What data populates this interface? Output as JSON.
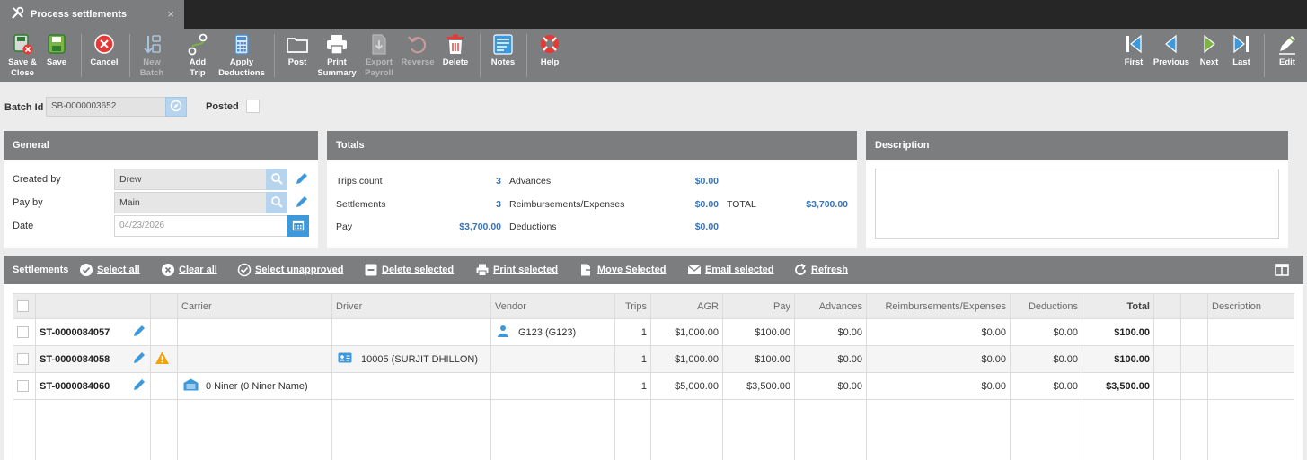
{
  "tab": {
    "title": "Process settlements",
    "close": "×"
  },
  "toolbar": {
    "save_close": [
      "Save &",
      "Close"
    ],
    "save": "Save",
    "cancel": "Cancel",
    "new_batch": [
      "New",
      "Batch"
    ],
    "add_trip": [
      "Add",
      "Trip"
    ],
    "apply_deductions": [
      "Apply",
      "Deductions"
    ],
    "post": "Post",
    "print_summary": [
      "Print",
      "Summary"
    ],
    "export_payroll": [
      "Export",
      "Payroll"
    ],
    "reverse": "Reverse",
    "delete": "Delete",
    "notes": "Notes",
    "help": "Help",
    "first": "First",
    "previous": "Previous",
    "next": "Next",
    "last": "Last",
    "edit": "Edit"
  },
  "batch": {
    "label": "Batch Id",
    "value": "SB-0000003652",
    "posted_label": "Posted"
  },
  "general": {
    "title": "General",
    "created_by_label": "Created by",
    "created_by": "Drew",
    "pay_by_label": "Pay by",
    "pay_by": "Main",
    "date_label": "Date",
    "date": "04/23/2026"
  },
  "totals": {
    "title": "Totals",
    "trips_count_label": "Trips count",
    "trips_count": "3",
    "settlements_label": "Settlements",
    "settlements": "3",
    "pay_label": "Pay",
    "pay": "$3,700.00",
    "advances_label": "Advances",
    "advances": "$0.00",
    "reimb_label": "Reimbursements/Expenses",
    "reimb": "$0.00",
    "deductions_label": "Deductions",
    "deductions": "$0.00",
    "total_label": "TOTAL",
    "total": "$3,700.00"
  },
  "description": {
    "title": "Description"
  },
  "settlements_bar": {
    "title": "Settlements",
    "select_all": "Select all",
    "clear_all": "Clear all",
    "select_unapproved": "Select unapproved",
    "delete_selected": "Delete selected",
    "print_selected": "Print selected",
    "move_selected": "Move Selected",
    "email_selected": "Email selected",
    "refresh": "Refresh"
  },
  "grid": {
    "headers": {
      "carrier": "Carrier",
      "driver": "Driver",
      "vendor": "Vendor",
      "trips": "Trips",
      "agr": "AGR",
      "pay": "Pay",
      "advances": "Advances",
      "reimb": "Reimbursements/Expenses",
      "deductions": "Deductions",
      "total": "Total",
      "description": "Description"
    },
    "rows": [
      {
        "id": "ST-0000084057",
        "carrier": "",
        "driver": "",
        "vendor": "G123 (G123)",
        "trips": "1",
        "agr": "$1,000.00",
        "pay": "$100.00",
        "advances": "$0.00",
        "reimb": "$0.00",
        "deductions": "$0.00",
        "total": "$100.00"
      },
      {
        "id": "ST-0000084058",
        "carrier": "",
        "driver": "10005 (SURJIT DHILLON)",
        "vendor": "",
        "trips": "1",
        "agr": "$1,000.00",
        "pay": "$100.00",
        "advances": "$0.00",
        "reimb": "$0.00",
        "deductions": "$0.00",
        "total": "$100.00"
      },
      {
        "id": "ST-0000084060",
        "carrier": "0 Niner (0 Niner Name)",
        "driver": "",
        "vendor": "",
        "trips": "1",
        "agr": "$5,000.00",
        "pay": "$3,500.00",
        "advances": "$0.00",
        "reimb": "$0.00",
        "deductions": "$0.00",
        "total": "$3,500.00"
      }
    ]
  },
  "colors": {
    "toolbar_bg": "#7b7d7f",
    "tabbar_bg": "#262626",
    "accent_blue": "#3c99dc",
    "value_blue": "#3a74b5",
    "warning": "#f0a30a"
  }
}
